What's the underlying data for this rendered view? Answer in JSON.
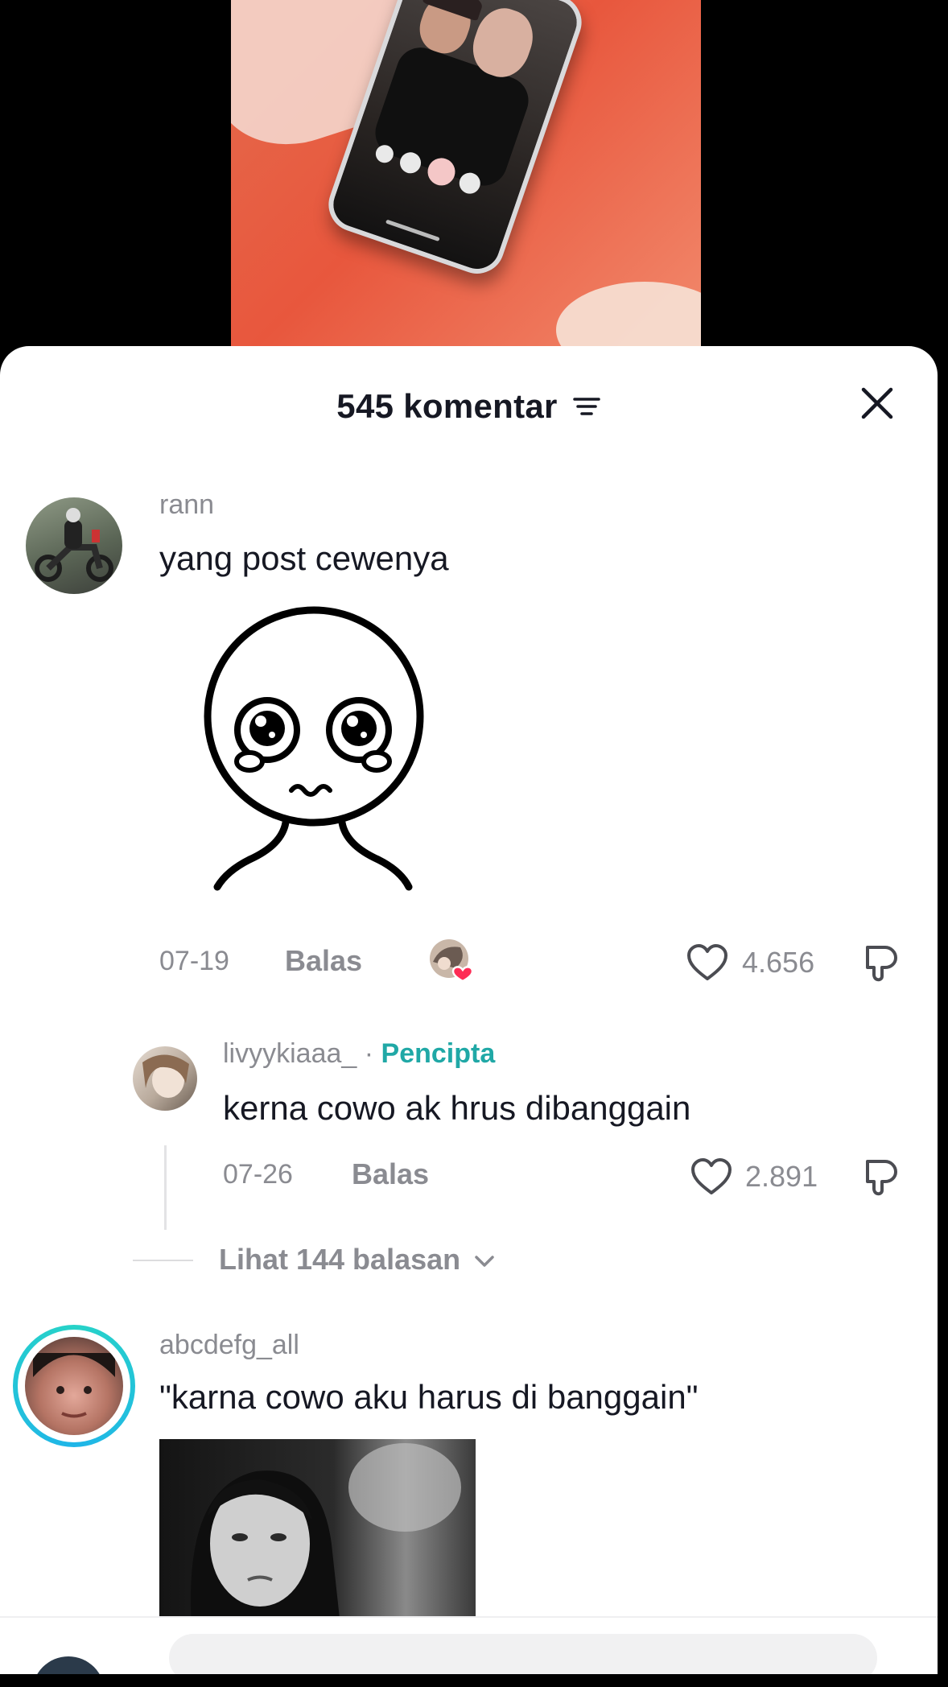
{
  "header": {
    "title": "545 komentar",
    "filter_icon": "sort-lines-icon",
    "close_icon": "close-x-icon"
  },
  "comments": [
    {
      "username": "rann",
      "text": "yang post cewenya",
      "sticker": "pleading-face-sticker",
      "date": "07-19",
      "reply_label": "Balas",
      "creator_liked": true,
      "likes": "4.656",
      "replies": [
        {
          "username": "livyykiaaa_",
          "separator": " · ",
          "badge": "Pencipta",
          "text": "kerna cowo ak hrus dibanggain",
          "date": "07-26",
          "reply_label": "Balas",
          "likes": "2.891"
        }
      ],
      "view_replies": "Lihat 144 balasan"
    },
    {
      "username": "abcdefg_all",
      "text": "\"karna cowo aku harus di banggain\"",
      "attachment": "crying-woman-gif"
    }
  ],
  "colors": {
    "accent": "#20a8a6",
    "like_badge": "#fe2c55",
    "text": "#161823",
    "muted": "#8a8b91"
  }
}
